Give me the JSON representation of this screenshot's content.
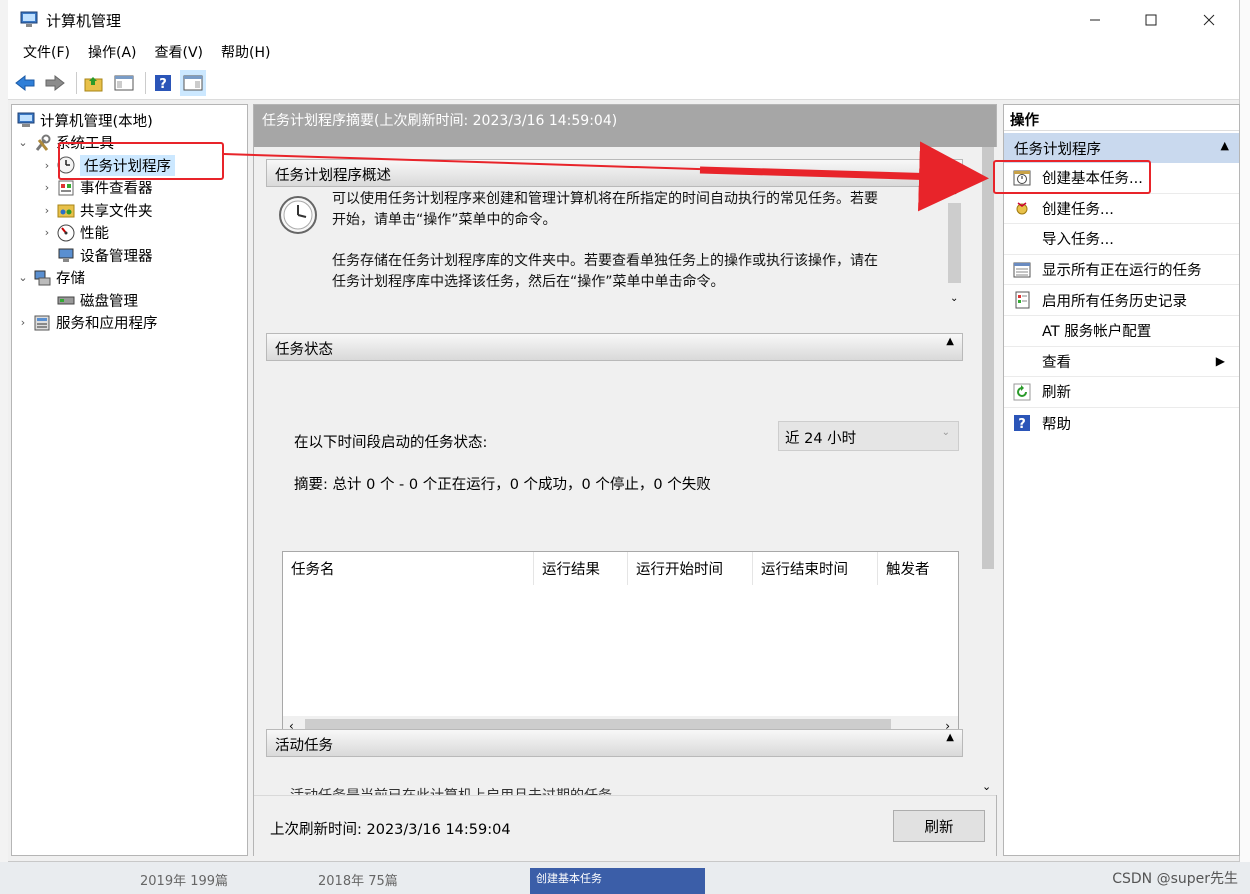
{
  "window": {
    "title": "计算机管理"
  },
  "menu": [
    "文件(F)",
    "操作(A)",
    "查看(V)",
    "帮助(H)"
  ],
  "tree": {
    "root": "计算机管理(本地)",
    "system_tools": "系统工具",
    "task_scheduler": "任务计划程序",
    "event_viewer": "事件查看器",
    "shared_folders": "共享文件夹",
    "performance": "性能",
    "device_manager": "设备管理器",
    "storage": "存储",
    "disk_management": "磁盘管理",
    "services_apps": "服务和应用程序"
  },
  "center": {
    "header": "任务计划程序摘要(上次刷新时间: 2023/3/16 14:59:04)",
    "overview_title": "任务计划程序概述",
    "overview_p1a": "可以使用任务计划程序来创建和管理计算机将在所指定的时间自动执行的常见任务。若要",
    "overview_p1b": "开始，请单击“操作”菜单中的命令。",
    "overview_p2a": "任务存储在任务计划程序库的文件夹中。若要查看单独任务上的操作或执行该操作，请在",
    "overview_p2b": "任务计划程序库中选择该任务，然后在“操作”菜单中单击命令。",
    "status_title": "任务状态",
    "status_prompt": "在以下时间段启动的任务状态:",
    "period_value": "近 24 小时",
    "summary": "摘要: 总计 0 个 - 0 个正在运行，0 个成功，0 个停止，0 个失败",
    "columns": [
      "任务名",
      "运行结果",
      "运行开始时间",
      "运行结束时间",
      "触发者"
    ],
    "active_title": "活动任务",
    "active_text": "活动任务是当前已在此计算机上启用且未过期的任务。",
    "last_refresh": "上次刷新时间: 2023/3/16 14:59:04",
    "refresh_button": "刷新"
  },
  "actions": {
    "header": "操作",
    "group": "任务计划程序",
    "items": [
      "创建基本任务...",
      "创建任务...",
      "导入任务...",
      "显示所有正在运行的任务",
      "启用所有任务历史记录",
      "AT 服务帐户配置",
      "查看",
      "刷新",
      "帮助"
    ]
  },
  "background": {
    "left_text_1": "2019年  199篇",
    "left_text_2": "2018年  75篇",
    "blue_tab": "创建基本任务",
    "watermark": "CSDN @super先生"
  },
  "colors": {
    "accent_red": "#e8242a",
    "selection": "#cce8ff",
    "group_bg": "#c9d9ee",
    "header_gray": "#a6a6a6"
  }
}
